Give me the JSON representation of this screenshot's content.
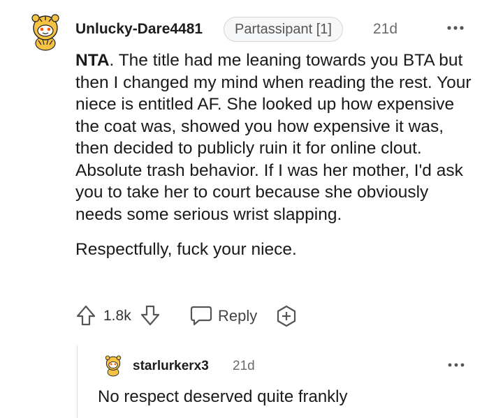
{
  "comment": {
    "author": "Unlucky-Dare4481",
    "flair": "Partassipant [1]",
    "age": "21d",
    "body_bold": "NTA",
    "body_rest": ". The title had me leaning towards you BTA but then I changed my mind when reading the rest. Your niece is entitled AF. She looked up how expensive the coat was, showed you how expensive it was, then decided to publicly ruin it for online clout. Absolute trash behavior. If I was her mother, I'd ask you to take her to court because she obviously needs some serious wrist slapping.",
    "body_p2": "Respectfully, fuck your niece.",
    "vote_count": "1.8k",
    "reply_label": "Reply"
  },
  "reply": {
    "author": "starlurkerx3",
    "age": "21d",
    "body": "No respect deserved quite frankly"
  },
  "colors": {
    "avatar_yellow": "#f5c244",
    "icon_gray": "#555555",
    "meta_gray": "#6b6b6b"
  },
  "icons": [
    "snoo-avatar-icon",
    "more-options-icon",
    "upvote-icon",
    "downvote-icon",
    "comment-bubble-icon",
    "award-add-icon"
  ]
}
